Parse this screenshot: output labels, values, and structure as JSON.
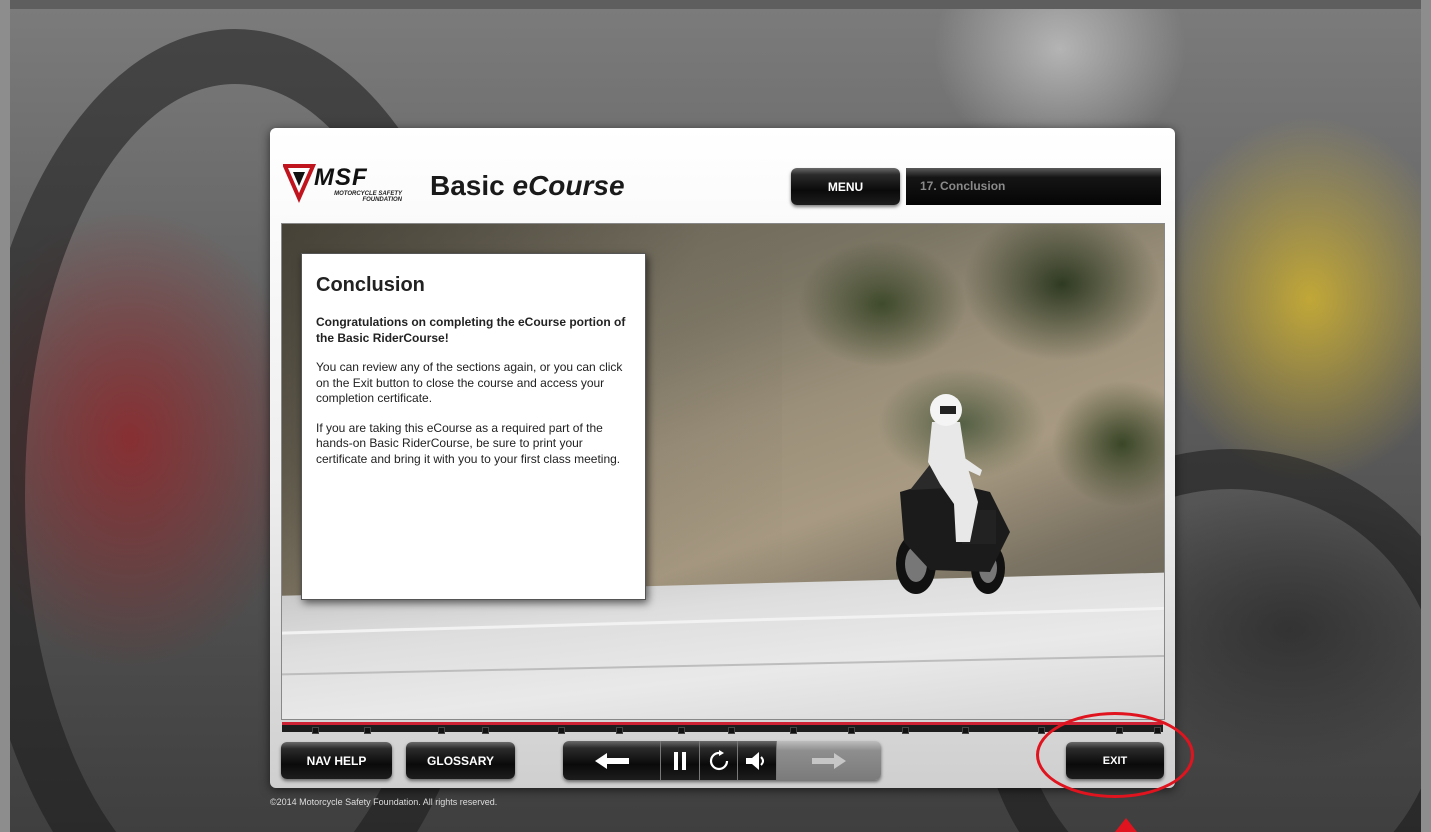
{
  "header": {
    "logo_text": "MSF",
    "logo_subtitle": "MOTORCYCLE SAFETY FOUNDATION",
    "course_title_prefix": "Basic ",
    "course_title_emphasis": "eCourse",
    "menu_label": "MENU",
    "current_topic": "17. Conclusion"
  },
  "card": {
    "title": "Conclusion",
    "congrats": "Congratulations on completing the eCourse portion of the Basic RiderCourse!",
    "paragraph1": "You can review any of the sections again, or you can click on the Exit button to close the course and access your completion certificate.",
    "paragraph2": "If you are taking this eCourse as a required part of the hands-on Basic RiderCourse, be sure to print your certificate and bring it with you to your first class meeting."
  },
  "footer": {
    "nav_help_label": "NAV HELP",
    "glossary_label": "GLOSSARY",
    "exit_label": "EXIT",
    "copyright": "©2014 Motorcycle Safety Foundation. All rights reserved."
  },
  "player": {
    "back_icon": "arrow-left-icon",
    "pause_icon": "pause-icon",
    "replay_icon": "replay-icon",
    "audio_icon": "speaker-icon",
    "next_icon": "arrow-right-icon"
  },
  "colors": {
    "accent_red": "#cc2233",
    "annotation_red": "#e0141e"
  }
}
